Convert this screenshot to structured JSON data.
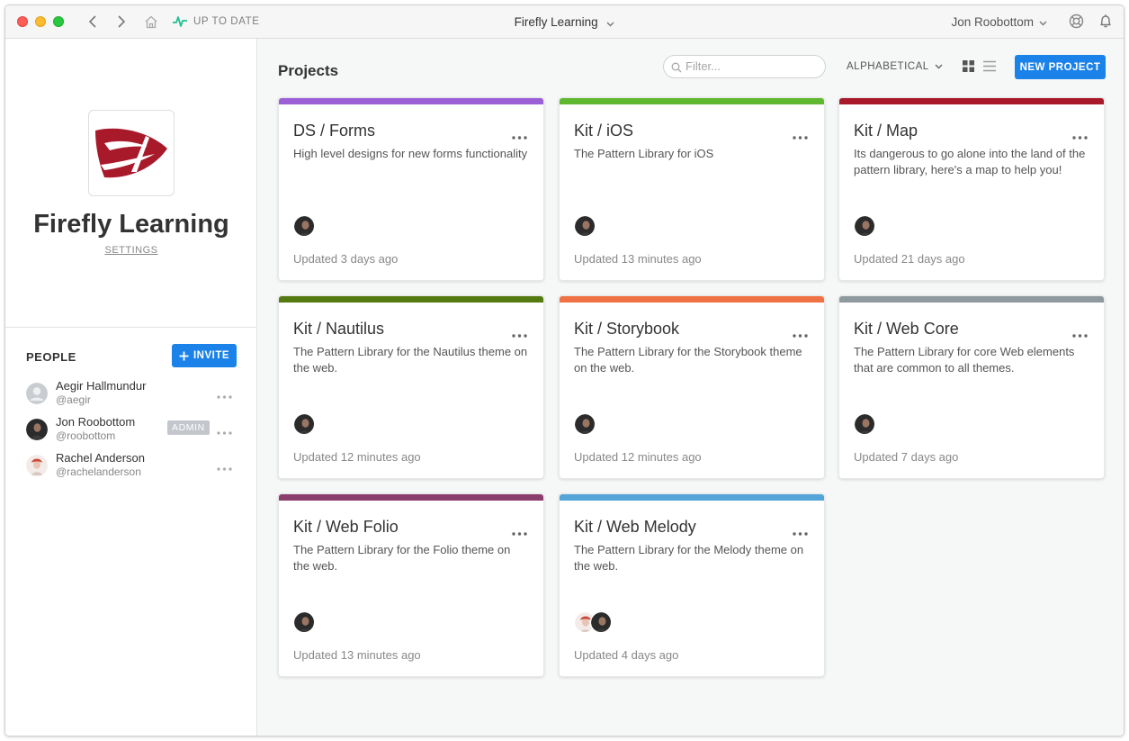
{
  "titlebar": {
    "status": "UP TO DATE",
    "title": "Firefly Learning",
    "user": "Jon Roobottom"
  },
  "sidebar": {
    "org_name": "Firefly Learning",
    "settings": "SETTINGS",
    "people_title": "PEOPLE",
    "invite_label": "INVITE",
    "people": [
      {
        "name": "Aegir Hallmundur",
        "handle": "@aegir",
        "avatar": "default-avatar-icon"
      },
      {
        "name": "Jon Roobottom",
        "handle": "@roobottom",
        "badge": "ADMIN",
        "avatar": "jon-avatar"
      },
      {
        "name": "Rachel Anderson",
        "handle": "@rachelanderson",
        "avatar": "rachel-avatar"
      }
    ]
  },
  "main": {
    "title": "Projects",
    "filter_placeholder": "Filter...",
    "sort_label": "ALPHABETICAL",
    "new_project_label": "NEW PROJECT",
    "projects": [
      {
        "title": "DS / Forms",
        "desc": "High level designs for new forms functionality",
        "updated": "Updated 3 days ago",
        "color": "#9b5fd6"
      },
      {
        "title": "Kit / iOS",
        "desc": "The Pattern Library for iOS",
        "updated": "Updated 13 minutes ago",
        "color": "#5fb82f"
      },
      {
        "title": "Kit / Map",
        "desc": "Its dangerous to go alone into the land of the pattern library, here's a map to help you!",
        "updated": "Updated 21 days ago",
        "color": "#a8192a"
      },
      {
        "title": "Kit / Nautilus",
        "desc": "The Pattern Library for the Nautilus theme on the web.",
        "updated": "Updated 12 minutes ago",
        "color": "#567a12"
      },
      {
        "title": "Kit / Storybook",
        "desc": "The Pattern Library for the Storybook theme on the web.",
        "updated": "Updated 12 minutes ago",
        "color": "#ef7244"
      },
      {
        "title": "Kit / Web Core",
        "desc": "The Pattern Library for core Web elements that are common to all themes.",
        "updated": "Updated 7 days ago",
        "color": "#8f9a9f"
      },
      {
        "title": "Kit / Web Folio",
        "desc": "The Pattern Library for the Folio theme on the web.",
        "updated": "Updated 13 minutes ago",
        "color": "#8b3e6b"
      },
      {
        "title": "Kit / Web Melody",
        "desc": "The Pattern Library for the Melody theme on the web.",
        "updated": "Updated 4 days ago",
        "color": "#54a4d8"
      }
    ]
  },
  "colors": {
    "accent": "#1a82e8",
    "status_green": "#1fbf8f",
    "logo_red": "#a8192a"
  }
}
